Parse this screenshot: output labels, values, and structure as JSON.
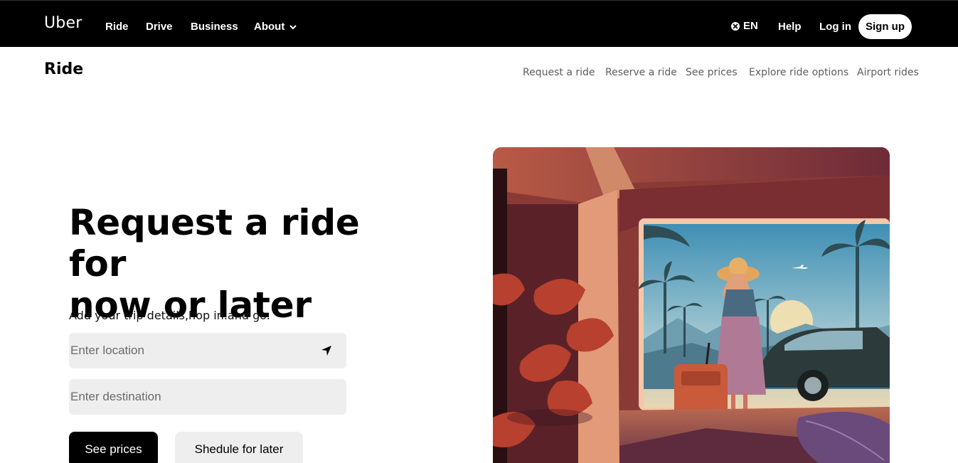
{
  "navbar": {
    "brand": "Uber",
    "links": [
      "Ride",
      "Drive",
      "Business",
      "About"
    ],
    "language": "EN",
    "help": "Help",
    "login": "Log in",
    "signup": "Sign up"
  },
  "subnav": {
    "title": "Ride",
    "links": [
      "Request a ride",
      "Reserve a ride",
      "See prices",
      "Explore ride options",
      "Airport rides"
    ]
  },
  "hero": {
    "title_line1": "Request a ride for",
    "title_line2": "now or later",
    "subtitle": "Add your trip details,hop in.and go.",
    "location_placeholder": "Enter location",
    "destination_placeholder": "Enter destination",
    "primary_button": "See prices",
    "secondary_button": "Shedule for later"
  },
  "colors": {
    "navbar_bg": "#000000",
    "field_bg": "#eeeeee",
    "sublink": "#5e5e5e"
  },
  "icons": [
    "globe-icon",
    "chevron-down-icon",
    "location-arrow-icon"
  ]
}
